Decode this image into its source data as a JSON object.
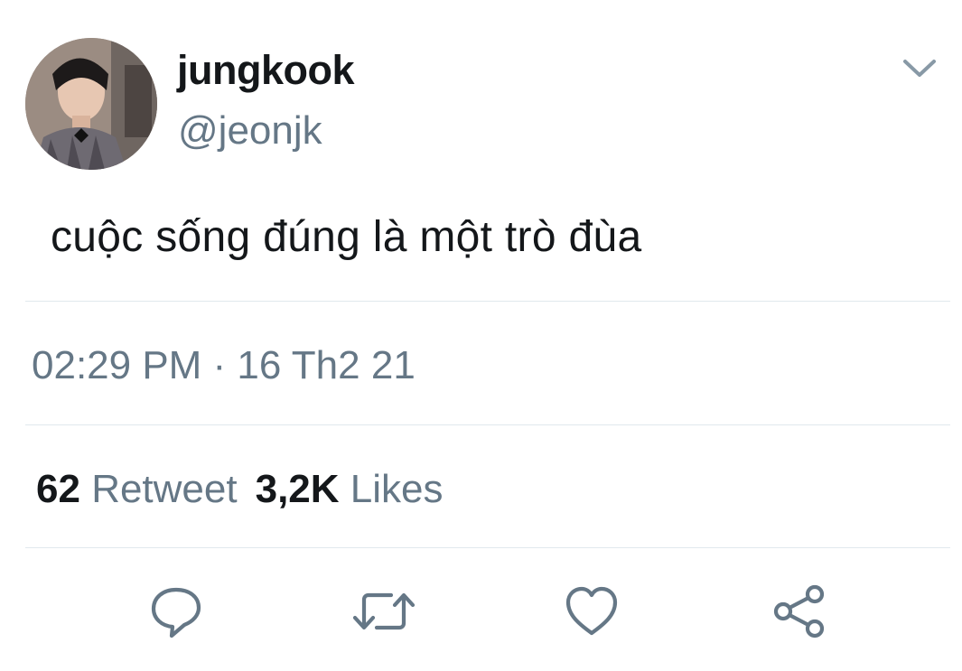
{
  "user": {
    "display_name": "jungkook",
    "handle": "@jeonjk"
  },
  "tweet": {
    "text": "cuộc sống đúng là một trò đùa",
    "timestamp": "02:29 PM · 16 Th2 21"
  },
  "stats": {
    "retweet_count": "62",
    "retweet_label": "Retweet",
    "likes_count": "3,2K",
    "likes_label": "Likes"
  },
  "actions": {
    "reply_icon": "reply-icon",
    "retweet_icon": "retweet-icon",
    "like_icon": "heart-icon",
    "share_icon": "share-icon"
  },
  "colors": {
    "text_primary": "#14171a",
    "text_secondary": "#657786",
    "divider": "#e1e8ed"
  }
}
